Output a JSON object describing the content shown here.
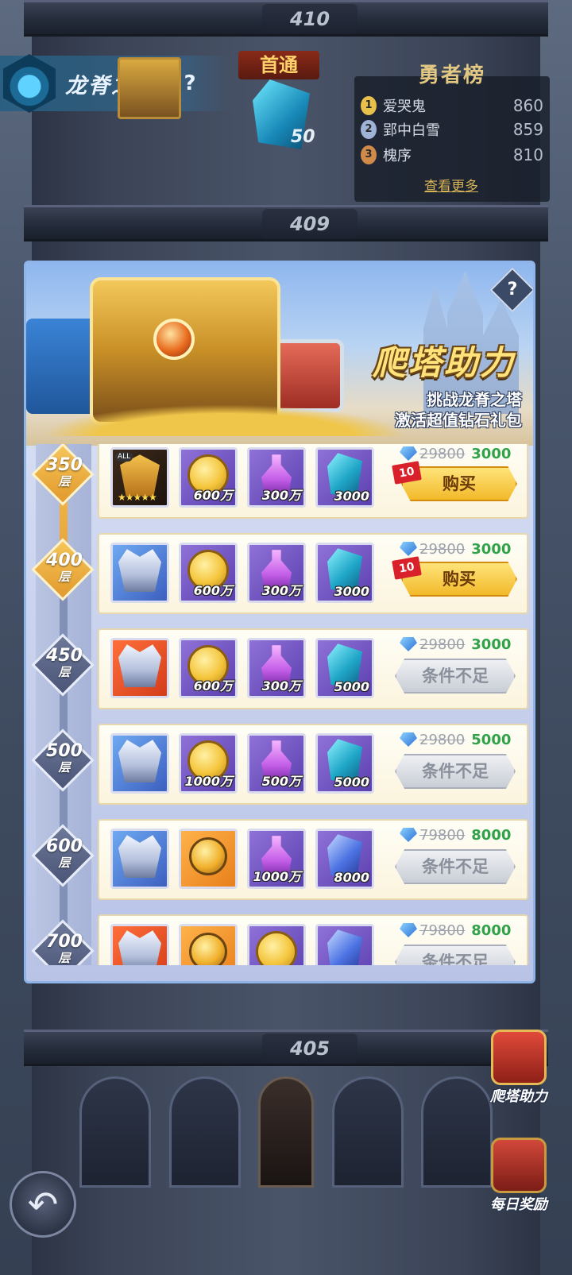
{
  "tower": {
    "floors_visible": [
      "410",
      "409",
      "405"
    ]
  },
  "header": {
    "title": "龙脊之塔",
    "help_icon": "?",
    "first_clear": {
      "label": "首通",
      "reward_icon": "crystal-icon",
      "reward_count": "50"
    }
  },
  "ranking": {
    "title": "勇者榜",
    "entries": [
      {
        "rank": "1",
        "name": "爱哭鬼",
        "score": "860"
      },
      {
        "rank": "2",
        "name": "郢中白雪",
        "score": "859"
      },
      {
        "rank": "3",
        "name": "槐序",
        "score": "810"
      }
    ],
    "more_label": "查看更多"
  },
  "dialog": {
    "help_icon": "?",
    "title": "爬塔助力",
    "subtitle_1": "挑战龙脊之塔",
    "subtitle_2": "激活超值钻石礼包",
    "packages": [
      {
        "floor": "350",
        "unit": "层",
        "reached": true,
        "items": [
          {
            "icon": "hero-mask-icon",
            "qty": "",
            "tag": "ALL",
            "stars": "★★★★★"
          },
          {
            "icon": "gold-coin-icon",
            "qty": "600万"
          },
          {
            "icon": "potion-icon",
            "qty": "300万"
          },
          {
            "icon": "crystal-icon",
            "qty": "3000"
          }
        ],
        "old_price": "29800",
        "new_price": "3000",
        "button": "购买",
        "limit": "10",
        "state": "buy"
      },
      {
        "floor": "400",
        "unit": "层",
        "reached": true,
        "items": [
          {
            "icon": "armor-icon",
            "qty": ""
          },
          {
            "icon": "gold-coin-icon",
            "qty": "600万"
          },
          {
            "icon": "potion-icon",
            "qty": "300万"
          },
          {
            "icon": "crystal-icon",
            "qty": "3000"
          }
        ],
        "old_price": "29800",
        "new_price": "3000",
        "button": "购买",
        "limit": "10",
        "state": "buy"
      },
      {
        "floor": "450",
        "unit": "层",
        "reached": false,
        "items": [
          {
            "icon": "armor-icon",
            "qty": ""
          },
          {
            "icon": "gold-coin-icon",
            "qty": "600万"
          },
          {
            "icon": "potion-icon",
            "qty": "300万"
          },
          {
            "icon": "crystal-icon",
            "qty": "5000"
          }
        ],
        "old_price": "29800",
        "new_price": "3000",
        "button": "条件不足",
        "state": "locked"
      },
      {
        "floor": "500",
        "unit": "层",
        "reached": false,
        "items": [
          {
            "icon": "armor-icon",
            "qty": ""
          },
          {
            "icon": "gold-coin-icon",
            "qty": "1000万"
          },
          {
            "icon": "potion-icon",
            "qty": "500万"
          },
          {
            "icon": "crystal-icon",
            "qty": "5000"
          }
        ],
        "old_price": "29800",
        "new_price": "5000",
        "button": "条件不足",
        "state": "locked"
      },
      {
        "floor": "600",
        "unit": "层",
        "reached": false,
        "items": [
          {
            "icon": "armor-icon",
            "qty": ""
          },
          {
            "icon": "amulet-icon",
            "qty": ""
          },
          {
            "icon": "potion-icon",
            "qty": "1000万"
          },
          {
            "icon": "blue-crystal-icon",
            "qty": "8000"
          }
        ],
        "old_price": "79800",
        "new_price": "8000",
        "button": "条件不足",
        "state": "locked"
      },
      {
        "floor": "700",
        "unit": "层",
        "reached": false,
        "items": [
          {
            "icon": "armor-icon",
            "qty": ""
          },
          {
            "icon": "amulet-icon",
            "qty": ""
          },
          {
            "icon": "gold-coin-icon",
            "qty": ""
          },
          {
            "icon": "blue-crystal-icon",
            "qty": ""
          }
        ],
        "old_price": "79800",
        "new_price": "8000",
        "button": "条件不足",
        "state": "locked"
      }
    ]
  },
  "side_buttons": {
    "climb_assist": "爬塔助力",
    "daily_reward": "每日奖励"
  },
  "back_icon": "back-arrow-icon",
  "colors": {
    "accent_gold": "#ffe27a",
    "price_green": "#2fa24a",
    "buy_yellow": "#f2b92a"
  }
}
